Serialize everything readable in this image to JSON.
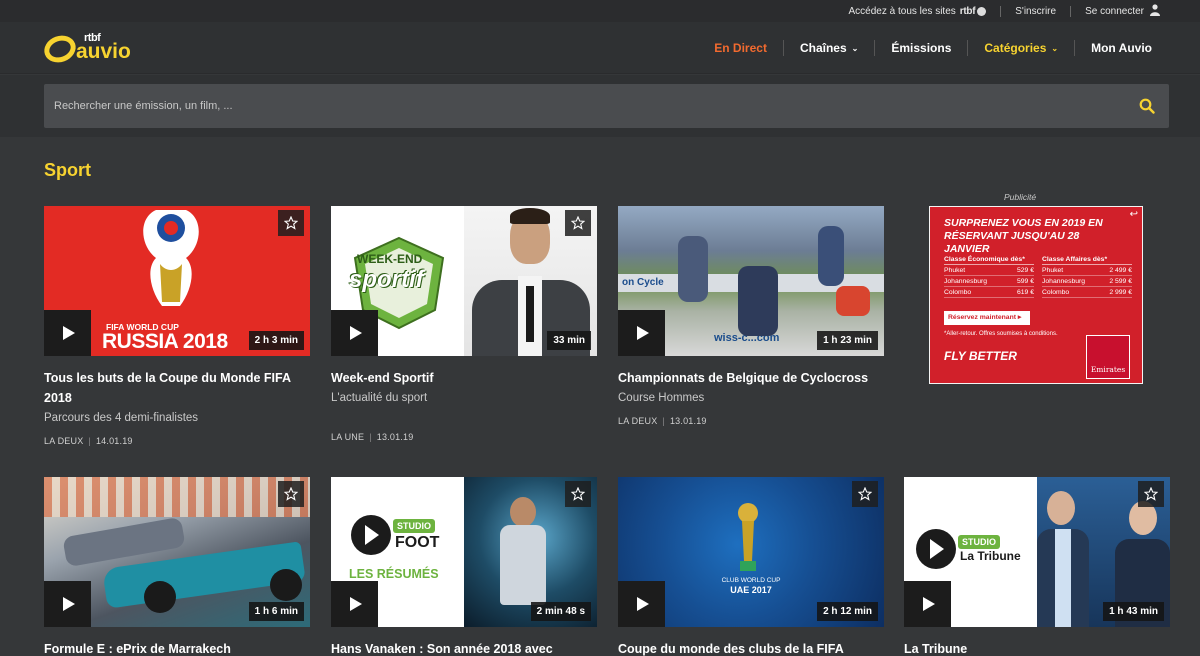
{
  "topbar": {
    "sites_label": "Accédez à tous les sites",
    "rtbf_label": "rtbf",
    "signup": "S'inscrire",
    "login": "Se connecter"
  },
  "logo": {
    "small": "rtbf",
    "main": "auvio"
  },
  "nav": {
    "live": "En Direct",
    "channels": "Chaînes",
    "shows": "Émissions",
    "categories": "Catégories",
    "account": "Mon Auvio"
  },
  "search": {
    "placeholder": "Rechercher une émission, un film, ..."
  },
  "section": {
    "title": "Sport"
  },
  "cards": [
    {
      "title": "Tous les buts de la Coupe du Monde FIFA 2018",
      "subtitle": "Parcours des 4 demi-finalistes",
      "channel": "LA DEUX",
      "date": "14.01.19",
      "duration": "2 h 3 min",
      "art_text1": "FIFA WORLD CUP",
      "art_text2": "RUSSIA 2018"
    },
    {
      "title": "Week-end Sportif",
      "subtitle": "L'actualité du sport",
      "channel": "LA UNE",
      "date": "13.01.19",
      "duration": "33 min",
      "art_text1": "WEEK-END",
      "art_text2": "sportif"
    },
    {
      "title": "Championnats de Belgique de Cyclocross",
      "subtitle": "Course Hommes",
      "channel": "LA DEUX",
      "date": "13.01.19",
      "duration": "1 h 23 min",
      "art_text1": "on Cycle",
      "art_text2": "wiss-c...com"
    },
    {
      "title": "Formule E : ePrix de Marrakech",
      "duration": "1 h 6 min"
    },
    {
      "title": "Hans Vanaken : Son année 2018 avec",
      "duration": "2 min 48 s",
      "art_text1": "STUDIO",
      "art_text2": "FOOT",
      "art_text3": "LES RÉSUMÉS"
    },
    {
      "title": "Coupe du monde des clubs de la FIFA",
      "duration": "2 h 12 min",
      "art_text1": "CLUB WORLD CUP",
      "art_text2": "UAE 2017"
    },
    {
      "title": "La Tribune",
      "duration": "1 h 43 min",
      "art_text1": "STUDIO",
      "art_text2": "La Tribune"
    }
  ],
  "ad": {
    "label": "Publicité",
    "headline": "Surprenez vous en 2019 en réservant jusqu'au 28 janvier",
    "eco_header": "Classe Économique dès*",
    "biz_header": "Classe Affaires dès*",
    "eco_rows": [
      {
        "city": "Phuket",
        "price": "529 €"
      },
      {
        "city": "Johannesburg",
        "price": "599 €"
      },
      {
        "city": "Colombo",
        "price": "619 €"
      }
    ],
    "biz_rows": [
      {
        "city": "Phuket",
        "price": "2 499 €"
      },
      {
        "city": "Johannesburg",
        "price": "2 599 €"
      },
      {
        "city": "Colombo",
        "price": "2 999 €"
      }
    ],
    "cta": "Réservez maintenant ▸",
    "conditions": "*Aller-retour. Offres soumises à conditions.",
    "slogan": "FLY BETTER",
    "brand": "Emirates"
  },
  "colors": {
    "accent": "#f7d330",
    "live": "#f26a2f",
    "background": "#353739"
  }
}
